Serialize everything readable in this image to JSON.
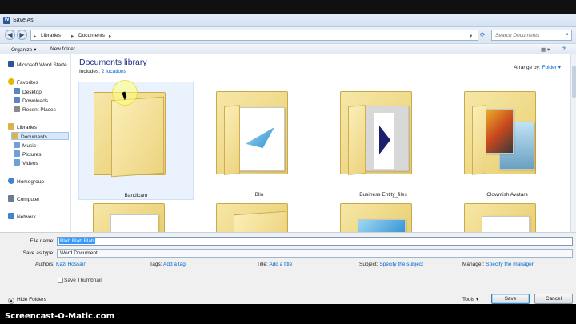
{
  "window": {
    "title": "Save As"
  },
  "address": {
    "crumbs": [
      "Libraries",
      "Documents"
    ],
    "search_placeholder": "Search Documents"
  },
  "toolbar": {
    "organize": "Organize ▾",
    "new_folder": "New folder"
  },
  "nav": {
    "items": [
      {
        "label": "Microsoft Word Starte",
        "color": "#2b579a"
      },
      {
        "label": "Favorites",
        "color": "#e6b800"
      },
      {
        "label": "Desktop",
        "color": "#5a86c4"
      },
      {
        "label": "Downloads",
        "color": "#5a86c4"
      },
      {
        "label": "Recent Places",
        "color": "#8a8a8a"
      },
      {
        "label": "Libraries",
        "color": "#d9b44a"
      },
      {
        "label": "Documents",
        "color": "#d9b44a"
      },
      {
        "label": "Music",
        "color": "#6fa0d8"
      },
      {
        "label": "Pictures",
        "color": "#6fa0d8"
      },
      {
        "label": "Videos",
        "color": "#6fa0d8"
      },
      {
        "label": "Homegroup",
        "color": "#3f86cf"
      },
      {
        "label": "Computer",
        "color": "#6a7c92"
      },
      {
        "label": "Network",
        "color": "#3f86cf"
      }
    ]
  },
  "library": {
    "title": "Documents library",
    "includes_label": "Includes:",
    "includes_link": "2 locations",
    "arrange_label": "Arrange by:",
    "arrange_value": "Folder ▾"
  },
  "folders": [
    {
      "name": "Bandicam"
    },
    {
      "name": "Blio"
    },
    {
      "name": "Business Entity_files"
    },
    {
      "name": "Clownfish Avatars"
    }
  ],
  "form": {
    "file_name_label": "File name:",
    "file_name_value": "Blah Blah Blah",
    "save_type_label": "Save as type:",
    "save_type_value": "Word Document",
    "authors_label": "Authors:",
    "authors_value": "Kazi Hossain",
    "tags_label": "Tags:",
    "tags_value": "Add a tag",
    "title_label": "Title:",
    "title_value": "Add a title",
    "subject_label": "Subject:",
    "subject_value": "Specify the subject",
    "manager_label": "Manager:",
    "manager_value": "Specify the manager",
    "thumbnail_label": "Save Thumbnail"
  },
  "footer": {
    "hide_folders": "Hide Folders",
    "tools": "Tools ▾",
    "save": "Save",
    "cancel": "Cancel"
  },
  "watermark": "Screencast-O-Matic.com"
}
